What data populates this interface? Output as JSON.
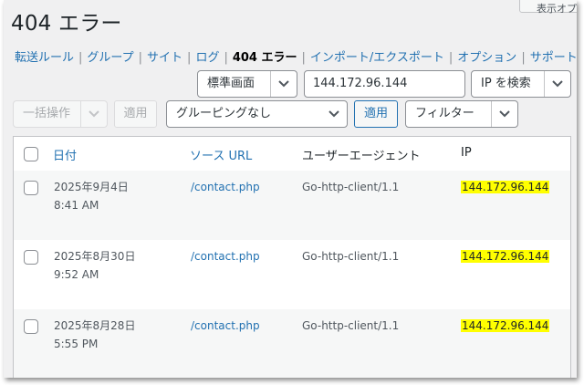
{
  "page": {
    "title": "404 エラー",
    "top_button": "表示オプ"
  },
  "subnav": [
    {
      "label": "転送ルール",
      "current": false
    },
    {
      "label": "グループ",
      "current": false
    },
    {
      "label": "サイト",
      "current": false
    },
    {
      "label": "ログ",
      "current": false
    },
    {
      "label": "404 エラー",
      "current": true
    },
    {
      "label": "インポート/エクスポート",
      "current": false
    },
    {
      "label": "オプション",
      "current": false
    },
    {
      "label": "サポート",
      "current": false
    }
  ],
  "search": {
    "view_select": "標準画面",
    "ip_value": "144.172.96.144",
    "search_select": "IP を検索"
  },
  "actions": {
    "bulk_select": "一括操作",
    "apply_label": "適用",
    "group_select": "グルーピングなし",
    "apply2_label": "適用",
    "filter_select": "フィルター"
  },
  "table": {
    "headers": {
      "date": "日付",
      "source": "ソース URL",
      "agent": "ユーザーエージェント",
      "ip": "IP"
    },
    "rows": [
      {
        "date": "2025年9月4日",
        "time": "8:41 AM",
        "url": "/contact.php",
        "agent": "Go-http-client/1.1",
        "ip": "144.172.96.144"
      },
      {
        "date": "2025年8月30日",
        "time": "9:52 AM",
        "url": "/contact.php",
        "agent": "Go-http-client/1.1",
        "ip": "144.172.96.144"
      },
      {
        "date": "2025年8月28日",
        "time": "5:55 PM",
        "url": "/contact.php",
        "agent": "Go-http-client/1.1",
        "ip": "144.172.96.144"
      }
    ]
  },
  "colors": {
    "link": "#2271b1",
    "highlight": "#ffff00",
    "background": "#f0f0f1"
  }
}
